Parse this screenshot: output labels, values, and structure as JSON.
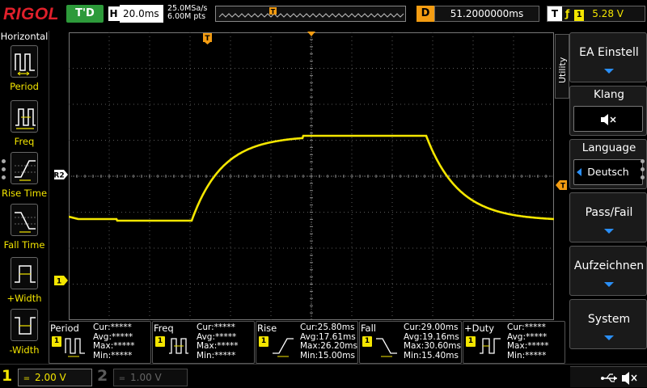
{
  "topbar": {
    "logo": "RIGOL",
    "trigger_status": "T'D",
    "horizontal_label": "H",
    "timebase": "20.0ms",
    "sample_rate": "25.0MSa/s",
    "memory_depth": "6.00M pts",
    "delay_label": "D",
    "delay_value": "51.2000000ms",
    "trigger_label": "T",
    "trigger_slope": "ƒ",
    "trigger_source": "1",
    "trigger_level": "5.28 V"
  },
  "left_panel": {
    "title": "Horizontal",
    "items": [
      {
        "label": "Period",
        "icon": "period-icon"
      },
      {
        "label": "Freq",
        "icon": "freq-icon"
      },
      {
        "label": "Rise Time",
        "icon": "rise-time-icon"
      },
      {
        "label": "Fall Time",
        "icon": "fall-time-icon"
      },
      {
        "label": "+Width",
        "icon": "plus-width-icon"
      },
      {
        "label": "-Width",
        "icon": "minus-width-icon"
      }
    ]
  },
  "screen": {
    "ref_marker": "R2",
    "ch1_marker": "1",
    "trigger_marker": "T",
    "colors": {
      "trace": "#f4e600",
      "grid": "#5a5a5a",
      "marker": "#f39c12"
    }
  },
  "right_menu": {
    "tab_label": "Utility",
    "items": [
      {
        "label": "EA Einstell",
        "type": "button"
      },
      {
        "label": "Klang",
        "type": "sub",
        "value": "🔇"
      },
      {
        "label": "Language",
        "type": "sub",
        "value": "Deutsch"
      },
      {
        "label": "Pass/Fail",
        "type": "button"
      },
      {
        "label": "Aufzeichnen",
        "type": "button"
      },
      {
        "label": "System",
        "type": "button"
      }
    ]
  },
  "measurements": [
    {
      "name": "Period",
      "ch": "1",
      "cur": "Cur:*****",
      "avg": "Avg:*****",
      "max": "Max:*****",
      "min": "Min:*****",
      "icon": "period-icon"
    },
    {
      "name": "Freq",
      "ch": "1",
      "cur": "Cur:*****",
      "avg": "Avg:*****",
      "max": "Max:*****",
      "min": "Min:*****",
      "icon": "freq-icon"
    },
    {
      "name": "Rise",
      "ch": "1",
      "cur": "Cur:25.80ms",
      "avg": "Avg:17.61ms",
      "max": "Max:26.20ms",
      "min": "Min:15.00ms",
      "icon": "rise-time-icon"
    },
    {
      "name": "Fall",
      "ch": "1",
      "cur": "Cur:29.00ms",
      "avg": "Avg:19.16ms",
      "max": "Max:30.60ms",
      "min": "Min:15.40ms",
      "icon": "fall-time-icon"
    },
    {
      "name": "+Duty",
      "ch": "1",
      "cur": "Cur:*****",
      "avg": "Avg:*****",
      "max": "Max:*****",
      "min": "Min:*****",
      "icon": "duty-icon"
    }
  ],
  "bottombar": {
    "ch1_label": "1",
    "ch1_coupling": "=",
    "ch1_scale": "2.00 V",
    "ch2_label": "2",
    "ch2_coupling": "=",
    "ch2_scale": "1.00 V"
  }
}
